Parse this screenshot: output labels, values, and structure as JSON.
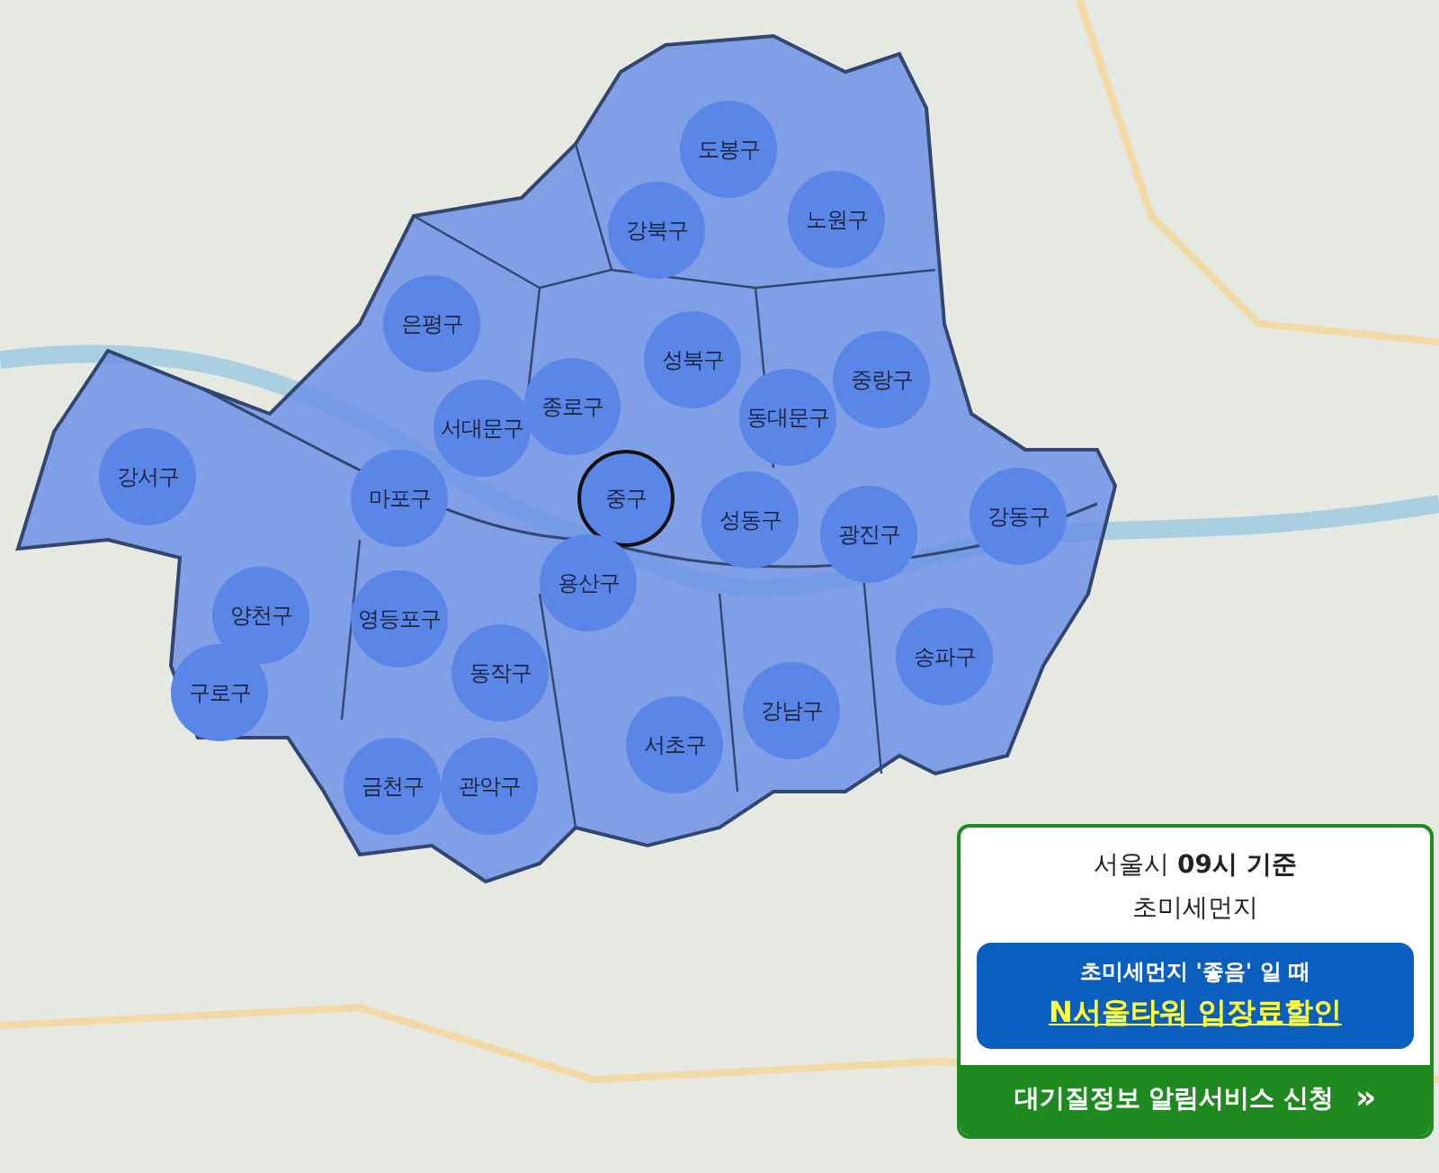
{
  "districts": [
    {
      "name": "도봉구",
      "selected": false
    },
    {
      "name": "노원구",
      "selected": false
    },
    {
      "name": "강북구",
      "selected": false
    },
    {
      "name": "은평구",
      "selected": false
    },
    {
      "name": "성북구",
      "selected": false
    },
    {
      "name": "중랑구",
      "selected": false
    },
    {
      "name": "종로구",
      "selected": false
    },
    {
      "name": "서대문구",
      "selected": false
    },
    {
      "name": "동대문구",
      "selected": false
    },
    {
      "name": "강서구",
      "selected": false
    },
    {
      "name": "마포구",
      "selected": false
    },
    {
      "name": "중구",
      "selected": true
    },
    {
      "name": "성동구",
      "selected": false
    },
    {
      "name": "광진구",
      "selected": false
    },
    {
      "name": "강동구",
      "selected": false
    },
    {
      "name": "용산구",
      "selected": false
    },
    {
      "name": "양천구",
      "selected": false
    },
    {
      "name": "영등포구",
      "selected": false
    },
    {
      "name": "송파구",
      "selected": false
    },
    {
      "name": "동작구",
      "selected": false
    },
    {
      "name": "구로구",
      "selected": false
    },
    {
      "name": "강남구",
      "selected": false
    },
    {
      "name": "서초구",
      "selected": false
    },
    {
      "name": "금천구",
      "selected": false
    },
    {
      "name": "관악구",
      "selected": false
    }
  ],
  "info_card": {
    "title": "서울시 **09시 기준**",
    "subtitle": "초미세먼지",
    "promo_caption": "초미세먼지 '좋음' 일 때",
    "promo_link": "N서울타워 입장료할인",
    "action": "대기질정보 알림서비스 신청",
    "action_icon": "»"
  }
}
